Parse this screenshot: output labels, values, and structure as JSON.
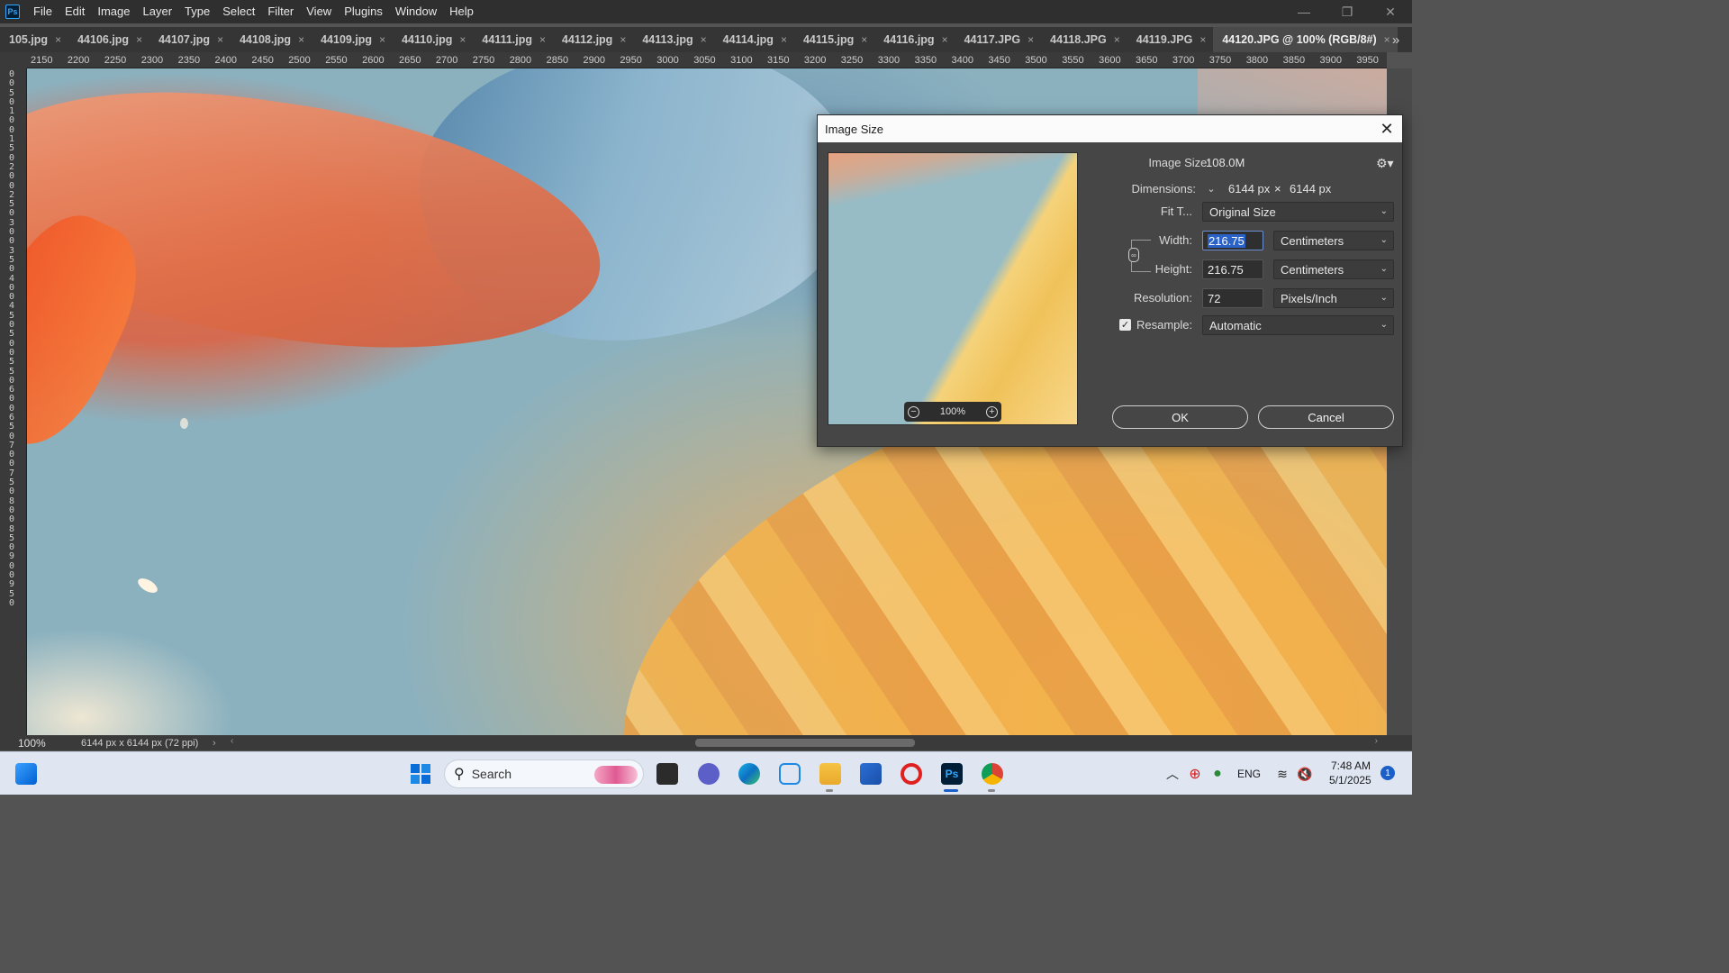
{
  "app": {
    "menu": [
      "File",
      "Edit",
      "Image",
      "Layer",
      "Type",
      "Select",
      "Filter",
      "View",
      "Plugins",
      "Window",
      "Help"
    ],
    "window_controls": {
      "minimize": "—",
      "restore": "❐",
      "close": "✕"
    }
  },
  "tabs": [
    {
      "label": "105.jpg"
    },
    {
      "label": "44106.jpg"
    },
    {
      "label": "44107.jpg"
    },
    {
      "label": "44108.jpg"
    },
    {
      "label": "44109.jpg"
    },
    {
      "label": "44110.jpg"
    },
    {
      "label": "44111.jpg"
    },
    {
      "label": "44112.jpg"
    },
    {
      "label": "44113.jpg"
    },
    {
      "label": "44114.jpg"
    },
    {
      "label": "44115.jpg"
    },
    {
      "label": "44116.jpg"
    },
    {
      "label": "44117.JPG"
    },
    {
      "label": "44118.JPG"
    },
    {
      "label": "44119.JPG"
    },
    {
      "label": "44120.JPG @ 100% (RGB/8#)",
      "active": true
    }
  ],
  "ruler": {
    "horizontal": [
      "2150",
      "2200",
      "2250",
      "2300",
      "2350",
      "2400",
      "2450",
      "2500",
      "2550",
      "2600",
      "2650",
      "2700",
      "2750",
      "2800",
      "2850",
      "2900",
      "2950",
      "3000",
      "3050",
      "3100",
      "3150",
      "3200",
      "3250",
      "3300",
      "3350",
      "3400",
      "3450",
      "3500",
      "3550",
      "3600",
      "3650",
      "3700",
      "3750",
      "3800",
      "3850",
      "3900",
      "3950"
    ],
    "vertical_digits": "0050100150200250300350400450500550600650700750800850900950"
  },
  "status": {
    "zoom": "100%",
    "doc_info": "6144 px x 6144 px (72 ppi)"
  },
  "dialog": {
    "title": "Image Size",
    "image_size_label": "Image Size:",
    "image_size_value": "108.0M",
    "dimensions_label": "Dimensions:",
    "dim_width": "6144 px",
    "dim_x": "×",
    "dim_height": "6144 px",
    "fit_label": "Fit T...",
    "fit_value": "Original Size",
    "width_label": "Width:",
    "width_value": "216.75",
    "width_unit": "Centimeters",
    "height_label": "Height:",
    "height_value": "216.75",
    "height_unit": "Centimeters",
    "resolution_label": "Resolution:",
    "resolution_value": "72",
    "resolution_unit": "Pixels/Inch",
    "resample_label": "Resample:",
    "resample_checked": true,
    "resample_value": "Automatic",
    "preview_zoom": "100%",
    "ok_label": "OK",
    "cancel_label": "Cancel"
  },
  "taskbar": {
    "search_label": "Search",
    "language": "ENG",
    "time": "7:48 AM",
    "date": "5/1/2025",
    "notification_count": "1"
  },
  "colors": {
    "ps_accent": "#31a8ff",
    "selection": "#2a62c8",
    "taskbar_active": "#1d5fc8"
  }
}
